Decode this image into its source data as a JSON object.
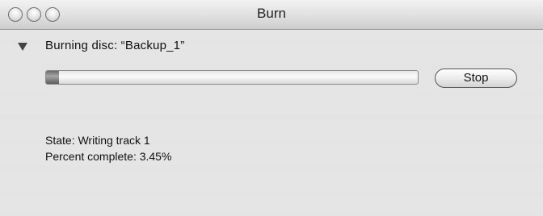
{
  "window": {
    "title": "Burn"
  },
  "burn": {
    "heading": "Burning disc: “Backup_1”",
    "progress_fraction": 0.0345,
    "stop_label": "Stop",
    "state_text": "State: Writing track 1",
    "percent_text": "Percent complete: 3.45%"
  },
  "icons": {
    "window_buttons": [
      "close-icon",
      "minimize-icon",
      "zoom-icon"
    ],
    "disclosure": "disclosure-triangle-icon"
  }
}
